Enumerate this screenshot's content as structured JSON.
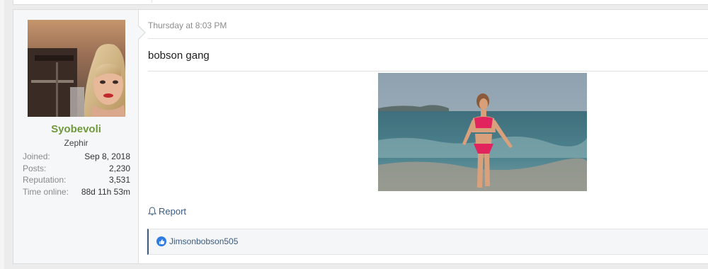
{
  "post": {
    "author": {
      "username": "Syobevoli",
      "title": "Zephir",
      "stats": [
        {
          "label": "Joined:",
          "value": "Sep 8, 2018"
        },
        {
          "label": "Posts:",
          "value": "2,230"
        },
        {
          "label": "Reputation:",
          "value": "3,531"
        },
        {
          "label": "Time online:",
          "value": "88d 11h 53m"
        }
      ]
    },
    "timestamp": "Thursday at 8:03 PM",
    "message": "bobson gang",
    "actions": {
      "report_label": "Report"
    },
    "reactions": {
      "users": "Jimsonbobson505"
    }
  },
  "colors": {
    "username": "#6e9a3b",
    "link": "#3b5a7e",
    "like": "#2f7be2"
  },
  "icons": {
    "report": "bell-icon",
    "reaction": "thumbs-up-icon"
  }
}
